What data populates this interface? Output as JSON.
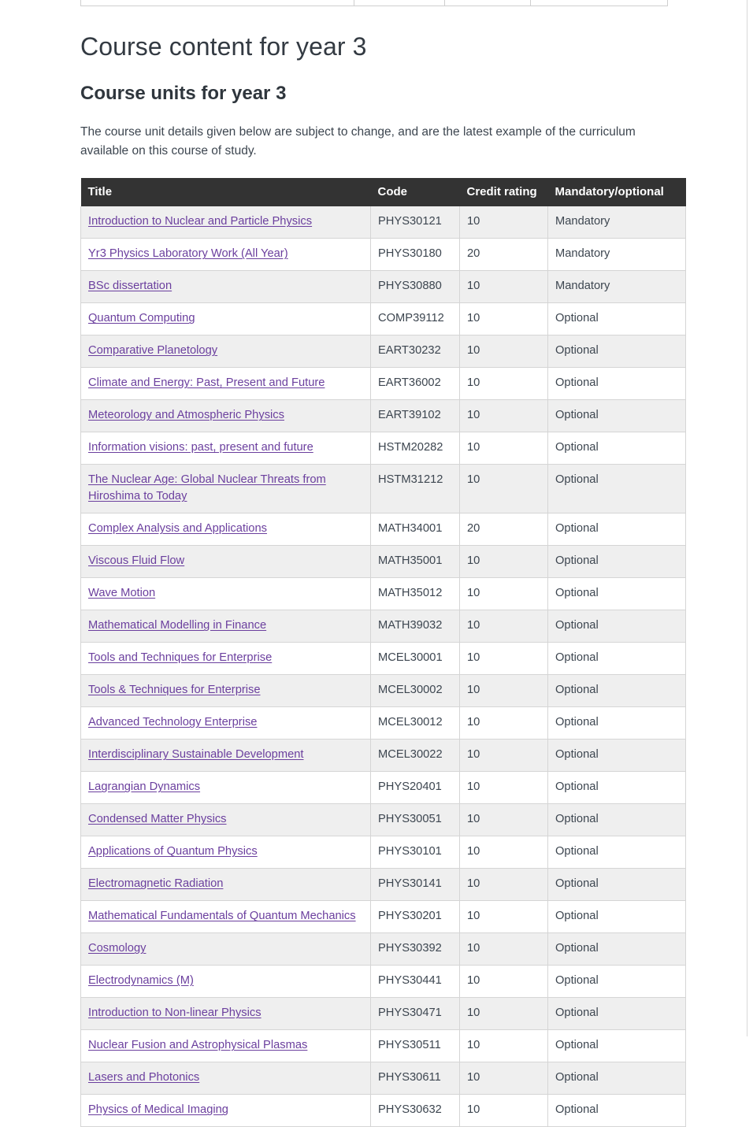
{
  "page": {
    "title": "Course content for year 3",
    "section_title": "Course units for year 3",
    "intro": "The course unit details given below are subject to change, and are the latest example of the curriculum available on this course of study."
  },
  "table": {
    "columns": [
      "Title",
      "Code",
      "Credit rating",
      "Mandatory/optional"
    ],
    "rows": [
      {
        "title": "Introduction to Nuclear and Particle Physics",
        "code": "PHYS30121",
        "credit": "10",
        "status": "Mandatory"
      },
      {
        "title": "Yr3 Physics Laboratory Work (All Year)",
        "code": "PHYS30180",
        "credit": "20",
        "status": "Mandatory"
      },
      {
        "title": "BSc dissertation",
        "code": "PHYS30880",
        "credit": "10",
        "status": "Mandatory"
      },
      {
        "title": "Quantum Computing",
        "code": "COMP39112",
        "credit": "10",
        "status": "Optional"
      },
      {
        "title": "Comparative Planetology",
        "code": "EART30232",
        "credit": "10",
        "status": "Optional"
      },
      {
        "title": "Climate and Energy: Past, Present and Future",
        "code": "EART36002",
        "credit": "10",
        "status": "Optional"
      },
      {
        "title": "Meteorology and Atmospheric Physics",
        "code": "EART39102",
        "credit": "10",
        "status": "Optional"
      },
      {
        "title": "Information visions: past, present and future",
        "code": "HSTM20282",
        "credit": "10",
        "status": "Optional"
      },
      {
        "title": "The Nuclear Age: Global Nuclear Threats from Hiroshima to Today",
        "code": "HSTM31212",
        "credit": "10",
        "status": "Optional"
      },
      {
        "title": "Complex Analysis and Applications",
        "code": "MATH34001",
        "credit": "20",
        "status": "Optional"
      },
      {
        "title": "Viscous Fluid Flow",
        "code": "MATH35001",
        "credit": "10",
        "status": "Optional"
      },
      {
        "title": "Wave Motion",
        "code": "MATH35012",
        "credit": "10",
        "status": "Optional"
      },
      {
        "title": "Mathematical Modelling in Finance",
        "code": "MATH39032",
        "credit": "10",
        "status": "Optional"
      },
      {
        "title": "Tools and Techniques for Enterprise",
        "code": "MCEL30001",
        "credit": "10",
        "status": "Optional"
      },
      {
        "title": "Tools & Techniques for Enterprise",
        "code": "MCEL30002",
        "credit": "10",
        "status": "Optional"
      },
      {
        "title": "Advanced Technology Enterprise",
        "code": "MCEL30012",
        "credit": "10",
        "status": "Optional"
      },
      {
        "title": "Interdisciplinary Sustainable Development",
        "code": "MCEL30022",
        "credit": "10",
        "status": "Optional"
      },
      {
        "title": "Lagrangian Dynamics",
        "code": "PHYS20401",
        "credit": "10",
        "status": "Optional"
      },
      {
        "title": "Condensed Matter Physics",
        "code": "PHYS30051",
        "credit": "10",
        "status": "Optional"
      },
      {
        "title": "Applications of Quantum Physics",
        "code": "PHYS30101",
        "credit": "10",
        "status": "Optional"
      },
      {
        "title": "Electromagnetic Radiation",
        "code": "PHYS30141",
        "credit": "10",
        "status": "Optional"
      },
      {
        "title": "Mathematical Fundamentals of Quantum Mechanics",
        "code": "PHYS30201",
        "credit": "10",
        "status": "Optional"
      },
      {
        "title": "Cosmology",
        "code": "PHYS30392",
        "credit": "10",
        "status": "Optional"
      },
      {
        "title": "Electrodynamics (M)",
        "code": "PHYS30441",
        "credit": "10",
        "status": "Optional"
      },
      {
        "title": "Introduction to Non-linear Physics",
        "code": "PHYS30471",
        "credit": "10",
        "status": "Optional"
      },
      {
        "title": "Nuclear Fusion and Astrophysical Plasmas",
        "code": "PHYS30511",
        "credit": "10",
        "status": "Optional"
      },
      {
        "title": "Lasers and Photonics",
        "code": "PHYS30611",
        "credit": "10",
        "status": "Optional"
      },
      {
        "title": "Physics of Medical Imaging",
        "code": "PHYS30632",
        "credit": "10",
        "status": "Optional"
      }
    ]
  },
  "colors": {
    "header_bg": "#333333",
    "header_text": "#ffffff",
    "link": "#6b3f9e",
    "row_alt_bg": "#efefef",
    "body_text": "#3d4650",
    "border": "#d5d5d5"
  }
}
